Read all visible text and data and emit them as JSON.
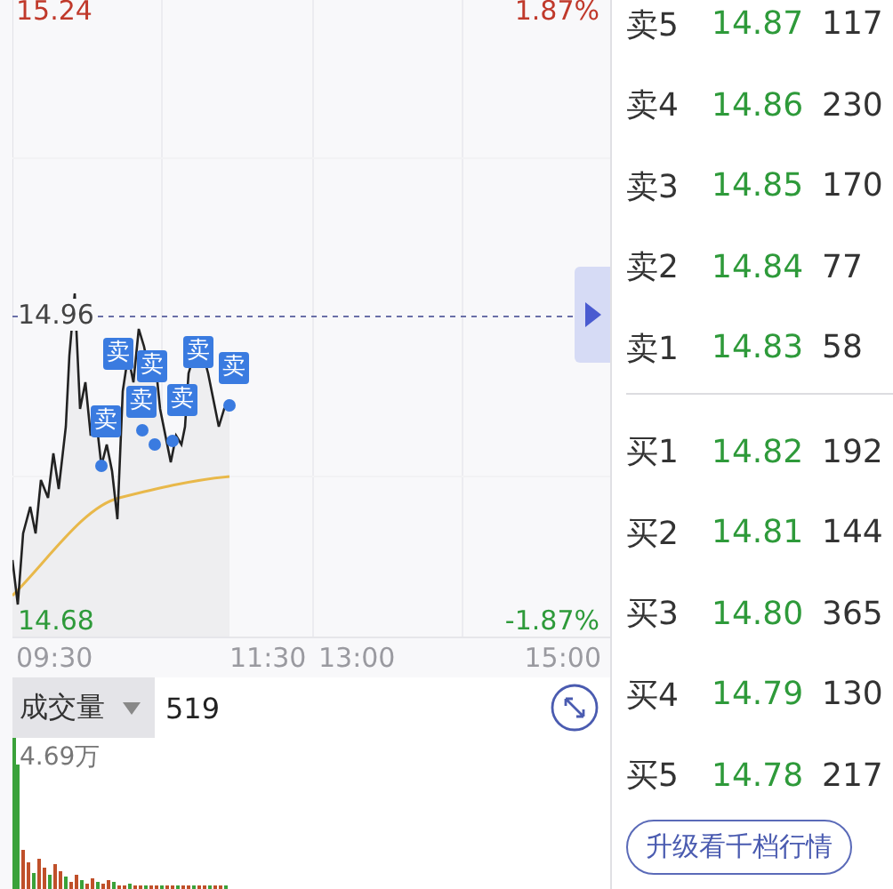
{
  "chart": {
    "price_high": "15.24",
    "pct_high": "1.87%",
    "price_mid": "14.96",
    "price_low": "14.68",
    "pct_low": "-1.87%",
    "times": [
      "09:30",
      "11:30",
      "13:00",
      "15:00"
    ],
    "markers": [
      {
        "label": "卖"
      },
      {
        "label": "卖"
      },
      {
        "label": "卖"
      },
      {
        "label": "卖"
      },
      {
        "label": "卖"
      },
      {
        "label": "卖"
      },
      {
        "label": "卖"
      }
    ]
  },
  "volume": {
    "indicator": "成交量",
    "value": "519",
    "max": "4.69万"
  },
  "order_book": {
    "asks": [
      {
        "label": "卖5",
        "price": "14.87",
        "volume": "117"
      },
      {
        "label": "卖4",
        "price": "14.86",
        "volume": "230"
      },
      {
        "label": "卖3",
        "price": "14.85",
        "volume": "170"
      },
      {
        "label": "卖2",
        "price": "14.84",
        "volume": "77"
      },
      {
        "label": "卖1",
        "price": "14.83",
        "volume": "58"
      }
    ],
    "bids": [
      {
        "label": "买1",
        "price": "14.82",
        "volume": "192"
      },
      {
        "label": "买2",
        "price": "14.81",
        "volume": "144"
      },
      {
        "label": "买3",
        "price": "14.80",
        "volume": "365"
      },
      {
        "label": "买4",
        "price": "14.79",
        "volume": "130"
      },
      {
        "label": "买5",
        "price": "14.78",
        "volume": "217"
      }
    ]
  },
  "upgrade_button": "升级看千档行情"
}
